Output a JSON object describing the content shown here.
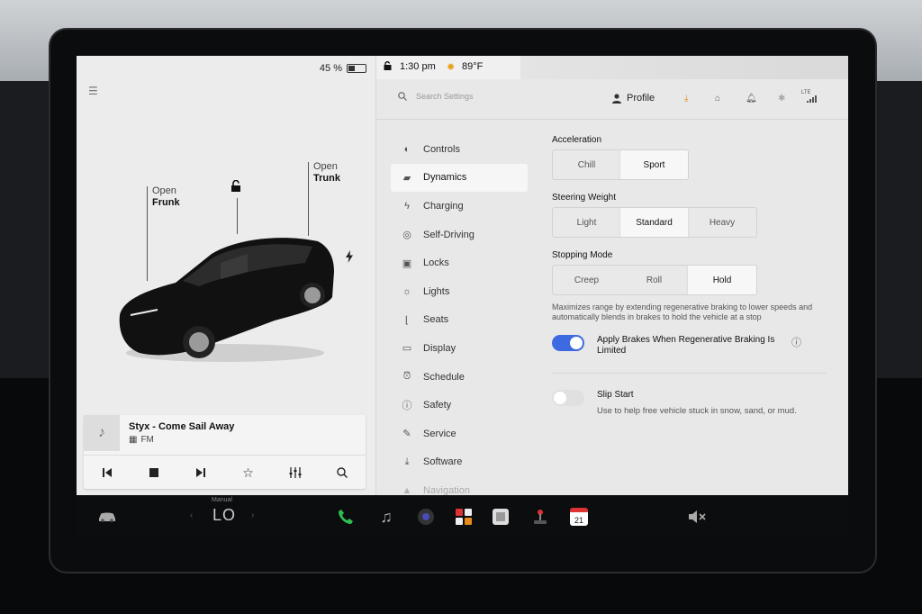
{
  "left_panel": {
    "battery_percent_label": "45 %",
    "battery_level": 0.45,
    "frunk": {
      "line1": "Open",
      "line2": "Frunk"
    },
    "trunk": {
      "line1": "Open",
      "line2": "Trunk"
    },
    "media": {
      "title": "Styx - Come Sail Away",
      "source": "FM"
    }
  },
  "status_bar": {
    "time": "1:30 pm",
    "temperature": "89°F"
  },
  "header": {
    "search_placeholder": "Search Settings",
    "profile_label": "Profile",
    "lte_label": "LTE"
  },
  "nav": {
    "items": [
      {
        "label": "Controls",
        "icon": "toggle-icon"
      },
      {
        "label": "Dynamics",
        "icon": "car-icon",
        "active": true
      },
      {
        "label": "Charging",
        "icon": "bolt-icon"
      },
      {
        "label": "Self-Driving",
        "icon": "steering-wheel-icon"
      },
      {
        "label": "Locks",
        "icon": "lock-icon"
      },
      {
        "label": "Lights",
        "icon": "light-icon"
      },
      {
        "label": "Seats",
        "icon": "seat-icon"
      },
      {
        "label": "Display",
        "icon": "display-icon"
      },
      {
        "label": "Schedule",
        "icon": "alarm-icon"
      },
      {
        "label": "Safety",
        "icon": "info-icon"
      },
      {
        "label": "Service",
        "icon": "wrench-icon"
      },
      {
        "label": "Software",
        "icon": "download-icon"
      },
      {
        "label": "Navigation",
        "icon": "navigation-icon"
      }
    ]
  },
  "settings": {
    "acceleration": {
      "label": "Acceleration",
      "options": [
        "Chill",
        "Sport"
      ],
      "selected": "Sport"
    },
    "steering_weight": {
      "label": "Steering Weight",
      "options": [
        "Light",
        "Standard",
        "Heavy"
      ],
      "selected": "Standard"
    },
    "stopping_mode": {
      "label": "Stopping Mode",
      "options": [
        "Creep",
        "Roll",
        "Hold"
      ],
      "selected": "Hold",
      "description": "Maximizes range by extending regenerative braking to lower speeds and automatically blends in brakes to hold the vehicle at a stop"
    },
    "apply_brakes": {
      "label": "Apply Brakes When Regenerative Braking Is Limited",
      "on": true
    },
    "slip_start": {
      "label": "Slip Start",
      "sub": "Use to help free vehicle stuck in snow, sand, or mud.",
      "on": false
    }
  },
  "dock": {
    "temp_mode": "Manual",
    "temp_value": "LO",
    "calendar_day": "21"
  },
  "colors": {
    "accent": "#3e6ae1",
    "download_orange": "#e88a1a",
    "phone_green": "#2fbf4f"
  }
}
